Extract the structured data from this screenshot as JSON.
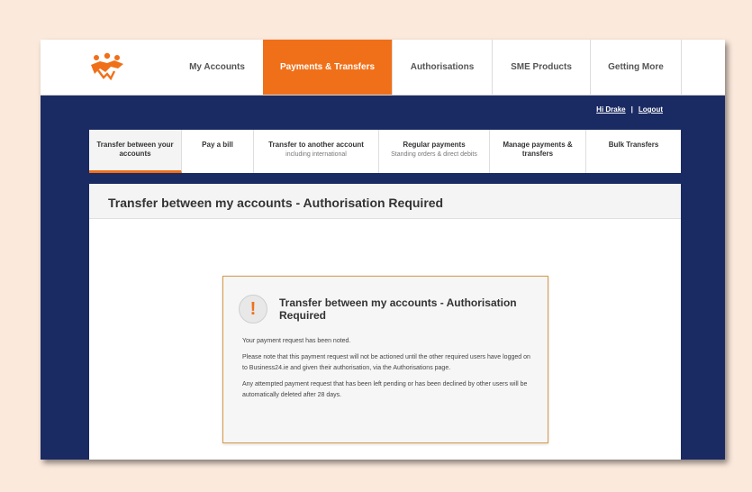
{
  "topnav": {
    "tabs": [
      {
        "label": "My Accounts"
      },
      {
        "label": "Payments & Transfers"
      },
      {
        "label": "Authorisations"
      },
      {
        "label": "SME Products"
      },
      {
        "label": "Getting More"
      }
    ]
  },
  "user": {
    "greeting": "Hi Drake",
    "separator": "|",
    "logout": "Logout"
  },
  "subnav": {
    "tabs": [
      {
        "label": "Transfer between your accounts",
        "sub": ""
      },
      {
        "label": "Pay a bill",
        "sub": ""
      },
      {
        "label": "Transfer to another account",
        "sub": "including international"
      },
      {
        "label": "Regular payments",
        "sub": "Standing orders & direct debits"
      },
      {
        "label": "Manage payments & transfers",
        "sub": ""
      },
      {
        "label": "Bulk Transfers",
        "sub": ""
      }
    ]
  },
  "page": {
    "title": "Transfer between my accounts - Authorisation Required"
  },
  "alert": {
    "icon": "!",
    "title": "Transfer between my accounts - Authorisation Required",
    "paragraphs": [
      "Your payment request has been noted.",
      "Please note that this payment request will not be actioned until the other required users have logged on to Business24.ie and given their authorisation, via the Authorisations page.",
      "Any attempted payment request that has been left pending or has been declined by other users will be automatically deleted after 28 days."
    ]
  },
  "colors": {
    "accent": "#f07019",
    "navy": "#1a2a63",
    "background": "#fbe9dc"
  }
}
